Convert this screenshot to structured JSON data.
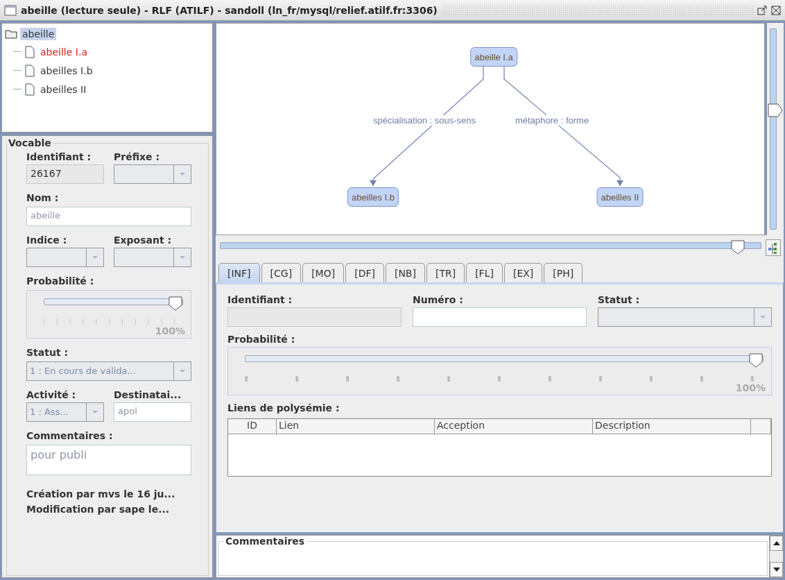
{
  "window": {
    "title": "abeille (lecture seule) - RLF (ATILF) - sandoll (ln_fr/mysql/relief.atilf.fr:3306)"
  },
  "tree": {
    "label": "abeille",
    "selected": true,
    "children": [
      {
        "label": "abeille I.a",
        "selected": false,
        "highlighted": true
      },
      {
        "label": "abeilles I.b",
        "selected": false,
        "highlighted": false
      },
      {
        "label": "abeilles II",
        "selected": false,
        "highlighted": false
      }
    ]
  },
  "vocable": {
    "title": "Vocable",
    "identifiant": {
      "label": "Identifiant :",
      "value": "26167"
    },
    "prefixe": {
      "label": "Préfixe :"
    },
    "nom": {
      "label": "Nom :",
      "value": "abeille"
    },
    "indice": {
      "label": "Indice :"
    },
    "exposant": {
      "label": "Exposant :"
    },
    "probabilite": {
      "label": "Probabilité :",
      "level": 1,
      "reading": "100%"
    },
    "statut": {
      "label": "Statut :",
      "value": "1 : En cours de valida..."
    },
    "activite": {
      "label": "Activité :",
      "value": "1 : Ass..."
    },
    "destinataire": {
      "label": "Destinatai...",
      "value": "apol"
    },
    "commentaires": {
      "label": "Commentaires :",
      "value": "pour publi"
    },
    "history": [
      "Création par mvs le 16 ju...",
      "Modification par sape le..."
    ]
  },
  "graph": {
    "nodes": [
      {
        "label": "abeille I.a"
      },
      {
        "label": "abeilles I.b"
      },
      {
        "label": "abeilles II"
      }
    ],
    "edges": [
      {
        "label": "spécialisation : sous-sens"
      },
      {
        "label": "métaphore : forme"
      }
    ],
    "vertical_slider": {
      "level": 0.6
    },
    "zoom_slider": {
      "level": 0.97
    }
  },
  "tabs": [
    {
      "label": "[INF]",
      "selected": true
    },
    {
      "label": "[CG]",
      "selected": false
    },
    {
      "label": "[MO]",
      "selected": false
    },
    {
      "label": "[DF]",
      "selected": false
    },
    {
      "label": "[NB]",
      "selected": false
    },
    {
      "label": "[TR]",
      "selected": false
    },
    {
      "label": "[FL]",
      "selected": false
    },
    {
      "label": "[EX]",
      "selected": false
    },
    {
      "label": "[PH]",
      "selected": false
    }
  ],
  "inf": {
    "identifiant": {
      "label": "Identifiant :"
    },
    "numero": {
      "label": "Numéro :"
    },
    "statut": {
      "label": "Statut :"
    },
    "probabilite": {
      "label": "Probabilité :",
      "level": 1,
      "reading": "100%"
    },
    "liens": {
      "label": "Liens de polysémie :",
      "columns": [
        "ID",
        "Lien",
        "Acception",
        "Description"
      ]
    }
  },
  "commentaires": {
    "title": "Commentaires"
  }
}
